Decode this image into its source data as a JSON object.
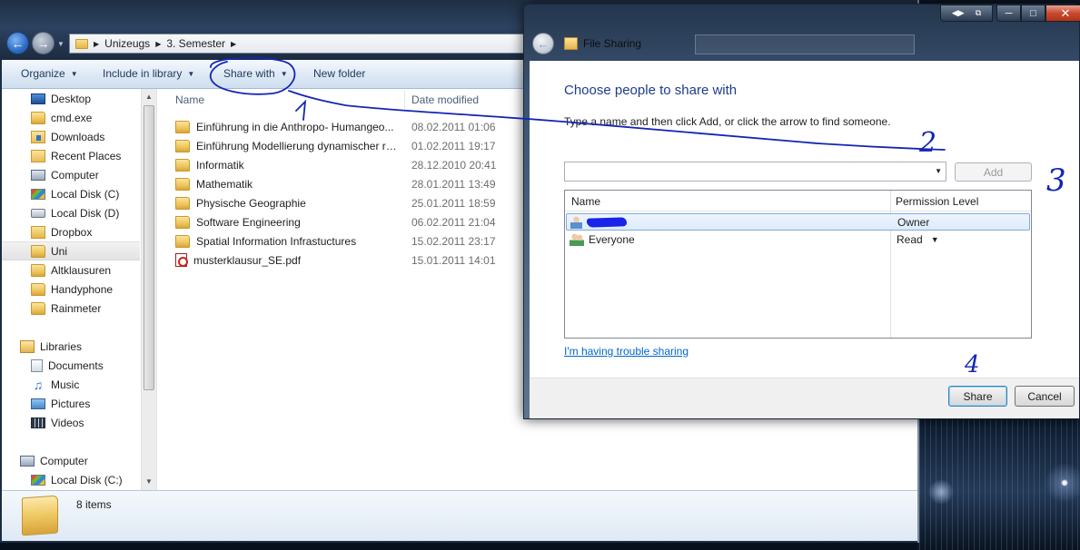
{
  "explorer": {
    "breadcrumb": [
      "Unizeugs",
      "3. Semester"
    ],
    "toolbar": {
      "organize": "Organize",
      "include_in_library": "Include in library",
      "share_with": "Share with",
      "new_folder": "New folder"
    },
    "nav_pane": {
      "favorites": [
        {
          "label": "Desktop",
          "icon": "desktop-icon"
        },
        {
          "label": "cmd.exe",
          "icon": "folder-icon"
        },
        {
          "label": "Downloads",
          "icon": "downloads-icon"
        },
        {
          "label": "Recent Places",
          "icon": "recent-places-icon"
        },
        {
          "label": "Computer",
          "icon": "computer-icon"
        },
        {
          "label": "Local Disk (C)",
          "icon": "local-disk-icon"
        },
        {
          "label": "Local Disk (D)",
          "icon": "local-disk-icon"
        },
        {
          "label": "Dropbox",
          "icon": "dropbox-icon"
        },
        {
          "label": "Uni",
          "icon": "folder-icon",
          "selected": true
        },
        {
          "label": "Altklausuren",
          "icon": "folder-icon"
        },
        {
          "label": "Handyphone",
          "icon": "folder-icon"
        },
        {
          "label": "Rainmeter",
          "icon": "folder-icon"
        }
      ],
      "libraries": {
        "label": "Libraries",
        "items": [
          {
            "label": "Documents",
            "icon": "documents-icon"
          },
          {
            "label": "Music",
            "icon": "music-icon"
          },
          {
            "label": "Pictures",
            "icon": "pictures-icon"
          },
          {
            "label": "Videos",
            "icon": "videos-icon"
          }
        ]
      },
      "computer": {
        "label": "Computer",
        "items": [
          {
            "label": "Local Disk (C:)",
            "icon": "local-disk-icon"
          }
        ]
      }
    },
    "columns": {
      "name": "Name",
      "date_modified": "Date modified"
    },
    "files": [
      {
        "name": "Einführung in die Anthropo- Humangeo...",
        "date": "08.02.2011 01:06",
        "icon": "folder-icon"
      },
      {
        "name": "Einführung Modellierung dynamischer rä...",
        "date": "01.02.2011 19:17",
        "icon": "folder-icon"
      },
      {
        "name": "Informatik",
        "date": "28.12.2010 20:41",
        "icon": "folder-icon"
      },
      {
        "name": "Mathematik",
        "date": "28.01.2011 13:49",
        "icon": "folder-icon"
      },
      {
        "name": "Physische Geographie",
        "date": "25.01.2011 18:59",
        "icon": "folder-icon"
      },
      {
        "name": "Software Engineering",
        "date": "06.02.2011 21:04",
        "icon": "folder-icon"
      },
      {
        "name": "Spatial Information Infrastuctures",
        "date": "15.02.2011 23:17",
        "icon": "folder-icon"
      },
      {
        "name": "musterklausur_SE.pdf",
        "date": "15.01.2011 14:01",
        "icon": "pdf-icon"
      }
    ],
    "details": {
      "items_count": "8 items"
    }
  },
  "dialog": {
    "title": "File Sharing",
    "heading": "Choose people to share with",
    "instruction": "Type a name and then click Add, or click the arrow to find someone.",
    "add_label": "Add",
    "table": {
      "col_name": "Name",
      "col_permission": "Permission Level",
      "rows": [
        {
          "name": "",
          "permission": "Owner",
          "icon": "user-icon",
          "redacted": true
        },
        {
          "name": "Everyone",
          "permission": "Read",
          "icon": "users-icon",
          "has_dropdown": true
        }
      ]
    },
    "trouble_link": "I'm having trouble sharing",
    "share_label": "Share",
    "cancel_label": "Cancel"
  },
  "annotations": {
    "labels": [
      "1",
      "2",
      "3",
      "4"
    ],
    "ink_color": "#1325b4"
  },
  "colors": {
    "dialog_heading": "#1e3c8c",
    "link": "#0066cc",
    "annotation_ink": "#1325b4"
  }
}
